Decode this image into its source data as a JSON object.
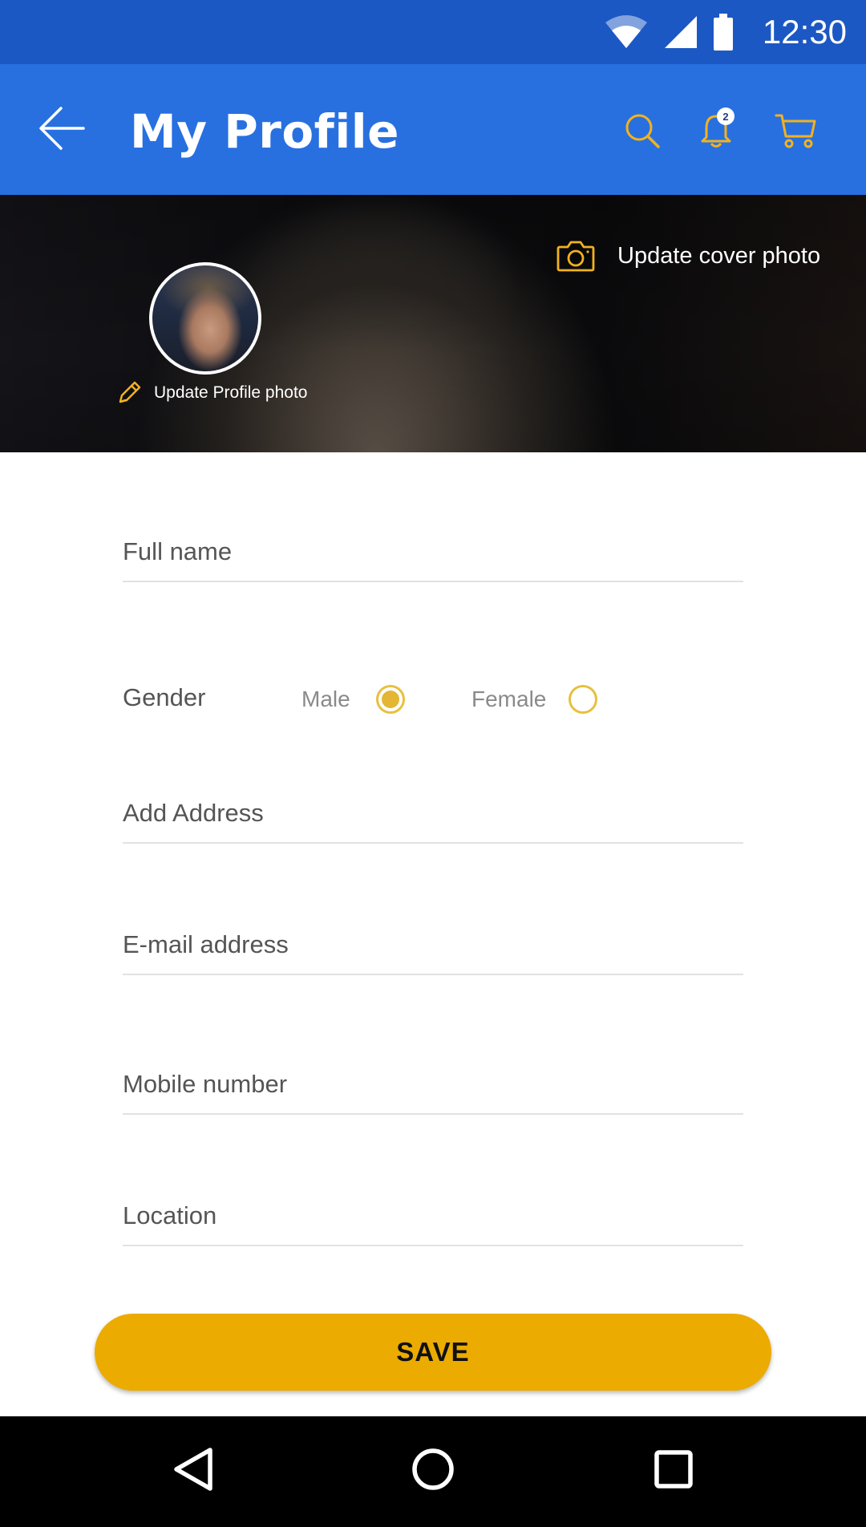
{
  "status_bar": {
    "time": "12:30",
    "icons": [
      "wifi-icon",
      "signal-icon",
      "battery-icon"
    ],
    "color": "#1c58c4"
  },
  "app_bar": {
    "title": "My Profile",
    "back_icon": "arrow-left-icon",
    "actions": [
      "search-icon",
      "bell-icon",
      "cart-icon"
    ],
    "notification_count": "2",
    "color": "#2870e0",
    "icon_color": "#f2b21f"
  },
  "cover": {
    "update_cover_label": "Update cover photo",
    "update_profile_label": "Update Profile photo",
    "camera_icon": "camera-icon",
    "pencil_icon": "pencil-icon"
  },
  "form": {
    "full_name_label": "Full name",
    "gender_label": "Gender",
    "gender_options": [
      {
        "label": "Male",
        "selected": true
      },
      {
        "label": "Female",
        "selected": false
      }
    ],
    "address_label": "Add Address",
    "email_label": "E-mail address",
    "mobile_label": "Mobile number",
    "location_label": "Location",
    "save_label": "SAVE",
    "accent_color": "#ecab00"
  },
  "nav_bar": {
    "icons": [
      "nav-back-icon",
      "nav-home-icon",
      "nav-recents-icon"
    ]
  }
}
